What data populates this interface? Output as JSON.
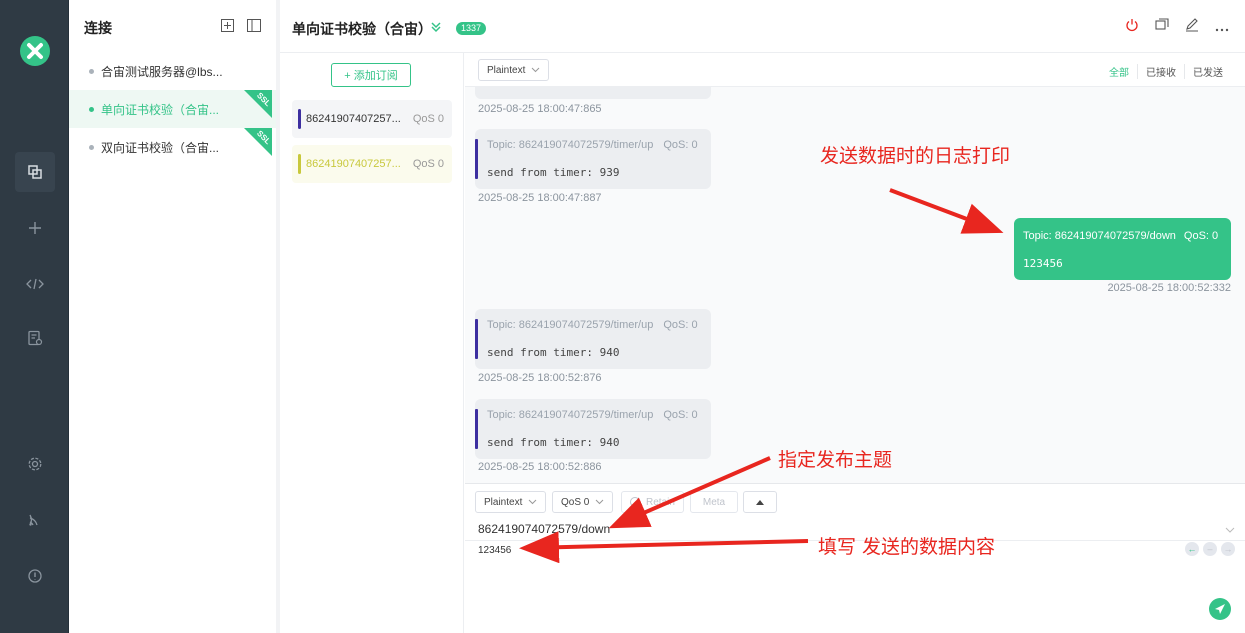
{
  "sidebar": {
    "icons": [
      "logo-icon",
      "connections-icon",
      "plus-icon",
      "script-icon",
      "log-icon",
      "settings-icon",
      "feed-icon",
      "info-icon"
    ]
  },
  "connections": {
    "title": "连接",
    "items": [
      {
        "label": "合宙测试服务器@lbs...",
        "active": false,
        "ssl": false
      },
      {
        "label": "单向证书校验（合宙...",
        "active": true,
        "ssl": true
      },
      {
        "label": "双向证书校验（合宙...",
        "active": false,
        "ssl": true
      }
    ],
    "ssl_label": "SSL"
  },
  "header": {
    "title": "单向证书校验（合宙）",
    "count": "1337"
  },
  "subscriptions": {
    "add_label": "+ 添加订阅",
    "items": [
      {
        "topic": "86241907407257...",
        "qos": "QoS 0",
        "color": "#3d2fa0"
      },
      {
        "topic": "86241907407257...",
        "qos": "QoS 0",
        "color": "#c8c83c"
      }
    ]
  },
  "messages": {
    "format": "Plaintext",
    "filters": [
      "全部",
      "已接收",
      "已发送"
    ],
    "list": [
      {
        "type": "in",
        "time": "2025-08-25 18:00:47:865"
      },
      {
        "type": "in",
        "topic": "Topic: 862419074072579/timer/up",
        "qos": "QoS: 0",
        "payload": "send from timer: 939",
        "time": "2025-08-25 18:00:47:887"
      },
      {
        "type": "out",
        "topic": "Topic: 862419074072579/down",
        "qos": "QoS: 0",
        "payload": "123456",
        "time": "2025-08-25 18:00:52:332"
      },
      {
        "type": "in",
        "topic": "Topic: 862419074072579/timer/up",
        "qos": "QoS: 0",
        "payload": "send from timer: 940",
        "time": "2025-08-25 18:00:52:876"
      },
      {
        "type": "in",
        "topic": "Topic: 862419074072579/timer/up",
        "qos": "QoS: 0",
        "payload": "send from timer: 940",
        "time": "2025-08-25 18:00:52:886"
      }
    ]
  },
  "compose": {
    "format": "Plaintext",
    "qos": "QoS 0",
    "retain": "Retain",
    "meta": "Meta",
    "topic": "862419074072579/down",
    "payload": "123456"
  },
  "annotations": {
    "log": "发送数据时的日志打印",
    "topic": "指定发布主题",
    "payload": "填写 发送的数据内容"
  },
  "colors": {
    "accent": "#34c388",
    "rail": "#2f3a44",
    "annotation": "#e8261f"
  }
}
